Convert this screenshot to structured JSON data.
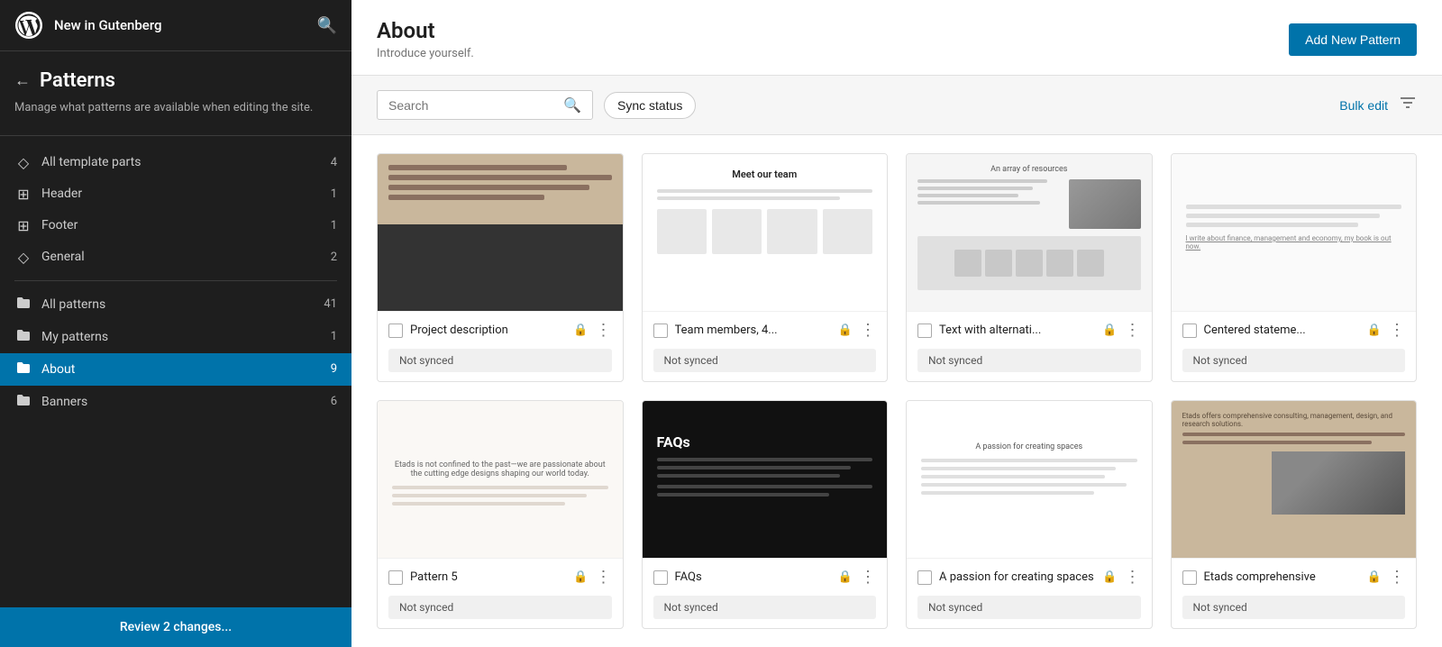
{
  "app": {
    "title": "New in Gutenberg",
    "search_placeholder": "Search"
  },
  "sidebar": {
    "title": "Patterns",
    "description": "Manage what patterns are available when editing the site.",
    "back_label": "Back",
    "nav_items": [
      {
        "id": "all-template-parts",
        "label": "All template parts",
        "count": 4,
        "icon": "diamond"
      },
      {
        "id": "header",
        "label": "Header",
        "count": 1,
        "icon": "layout"
      },
      {
        "id": "footer",
        "label": "Footer",
        "count": 1,
        "icon": "layout"
      },
      {
        "id": "general",
        "label": "General",
        "count": 2,
        "icon": "diamond"
      }
    ],
    "pattern_items": [
      {
        "id": "all-patterns",
        "label": "All patterns",
        "count": 41,
        "icon": "folder"
      },
      {
        "id": "my-patterns",
        "label": "My patterns",
        "count": 1,
        "icon": "folder"
      },
      {
        "id": "about",
        "label": "About",
        "count": 9,
        "icon": "folder",
        "active": true
      },
      {
        "id": "banners",
        "label": "Banners",
        "count": 6,
        "icon": "folder"
      }
    ],
    "review_label": "Review 2 changes..."
  },
  "main": {
    "title": "About",
    "subtitle": "Introduce yourself.",
    "add_new_label": "Add New Pattern",
    "search_placeholder": "Search",
    "sync_status_label": "Sync status",
    "bulk_edit_label": "Bulk edit",
    "patterns": [
      {
        "id": 1,
        "name": "Project description",
        "sync_status": "Not synced",
        "preview_type": "1"
      },
      {
        "id": 2,
        "name": "Team members, 4...",
        "sync_status": "Not synced",
        "preview_type": "2"
      },
      {
        "id": 3,
        "name": "Text with alternati...",
        "sync_status": "Not synced",
        "preview_type": "3"
      },
      {
        "id": 4,
        "name": "Centered stateme...",
        "sync_status": "Not synced",
        "preview_type": "4"
      },
      {
        "id": 5,
        "name": "Pattern 5",
        "sync_status": "Not synced",
        "preview_type": "5"
      },
      {
        "id": 6,
        "name": "FAQs",
        "sync_status": "Not synced",
        "preview_type": "6"
      },
      {
        "id": 7,
        "name": "A passion for creating spaces",
        "sync_status": "Not synced",
        "preview_type": "7"
      },
      {
        "id": 8,
        "name": "Etads comprehensive",
        "sync_status": "Not synced",
        "preview_type": "8"
      }
    ]
  }
}
